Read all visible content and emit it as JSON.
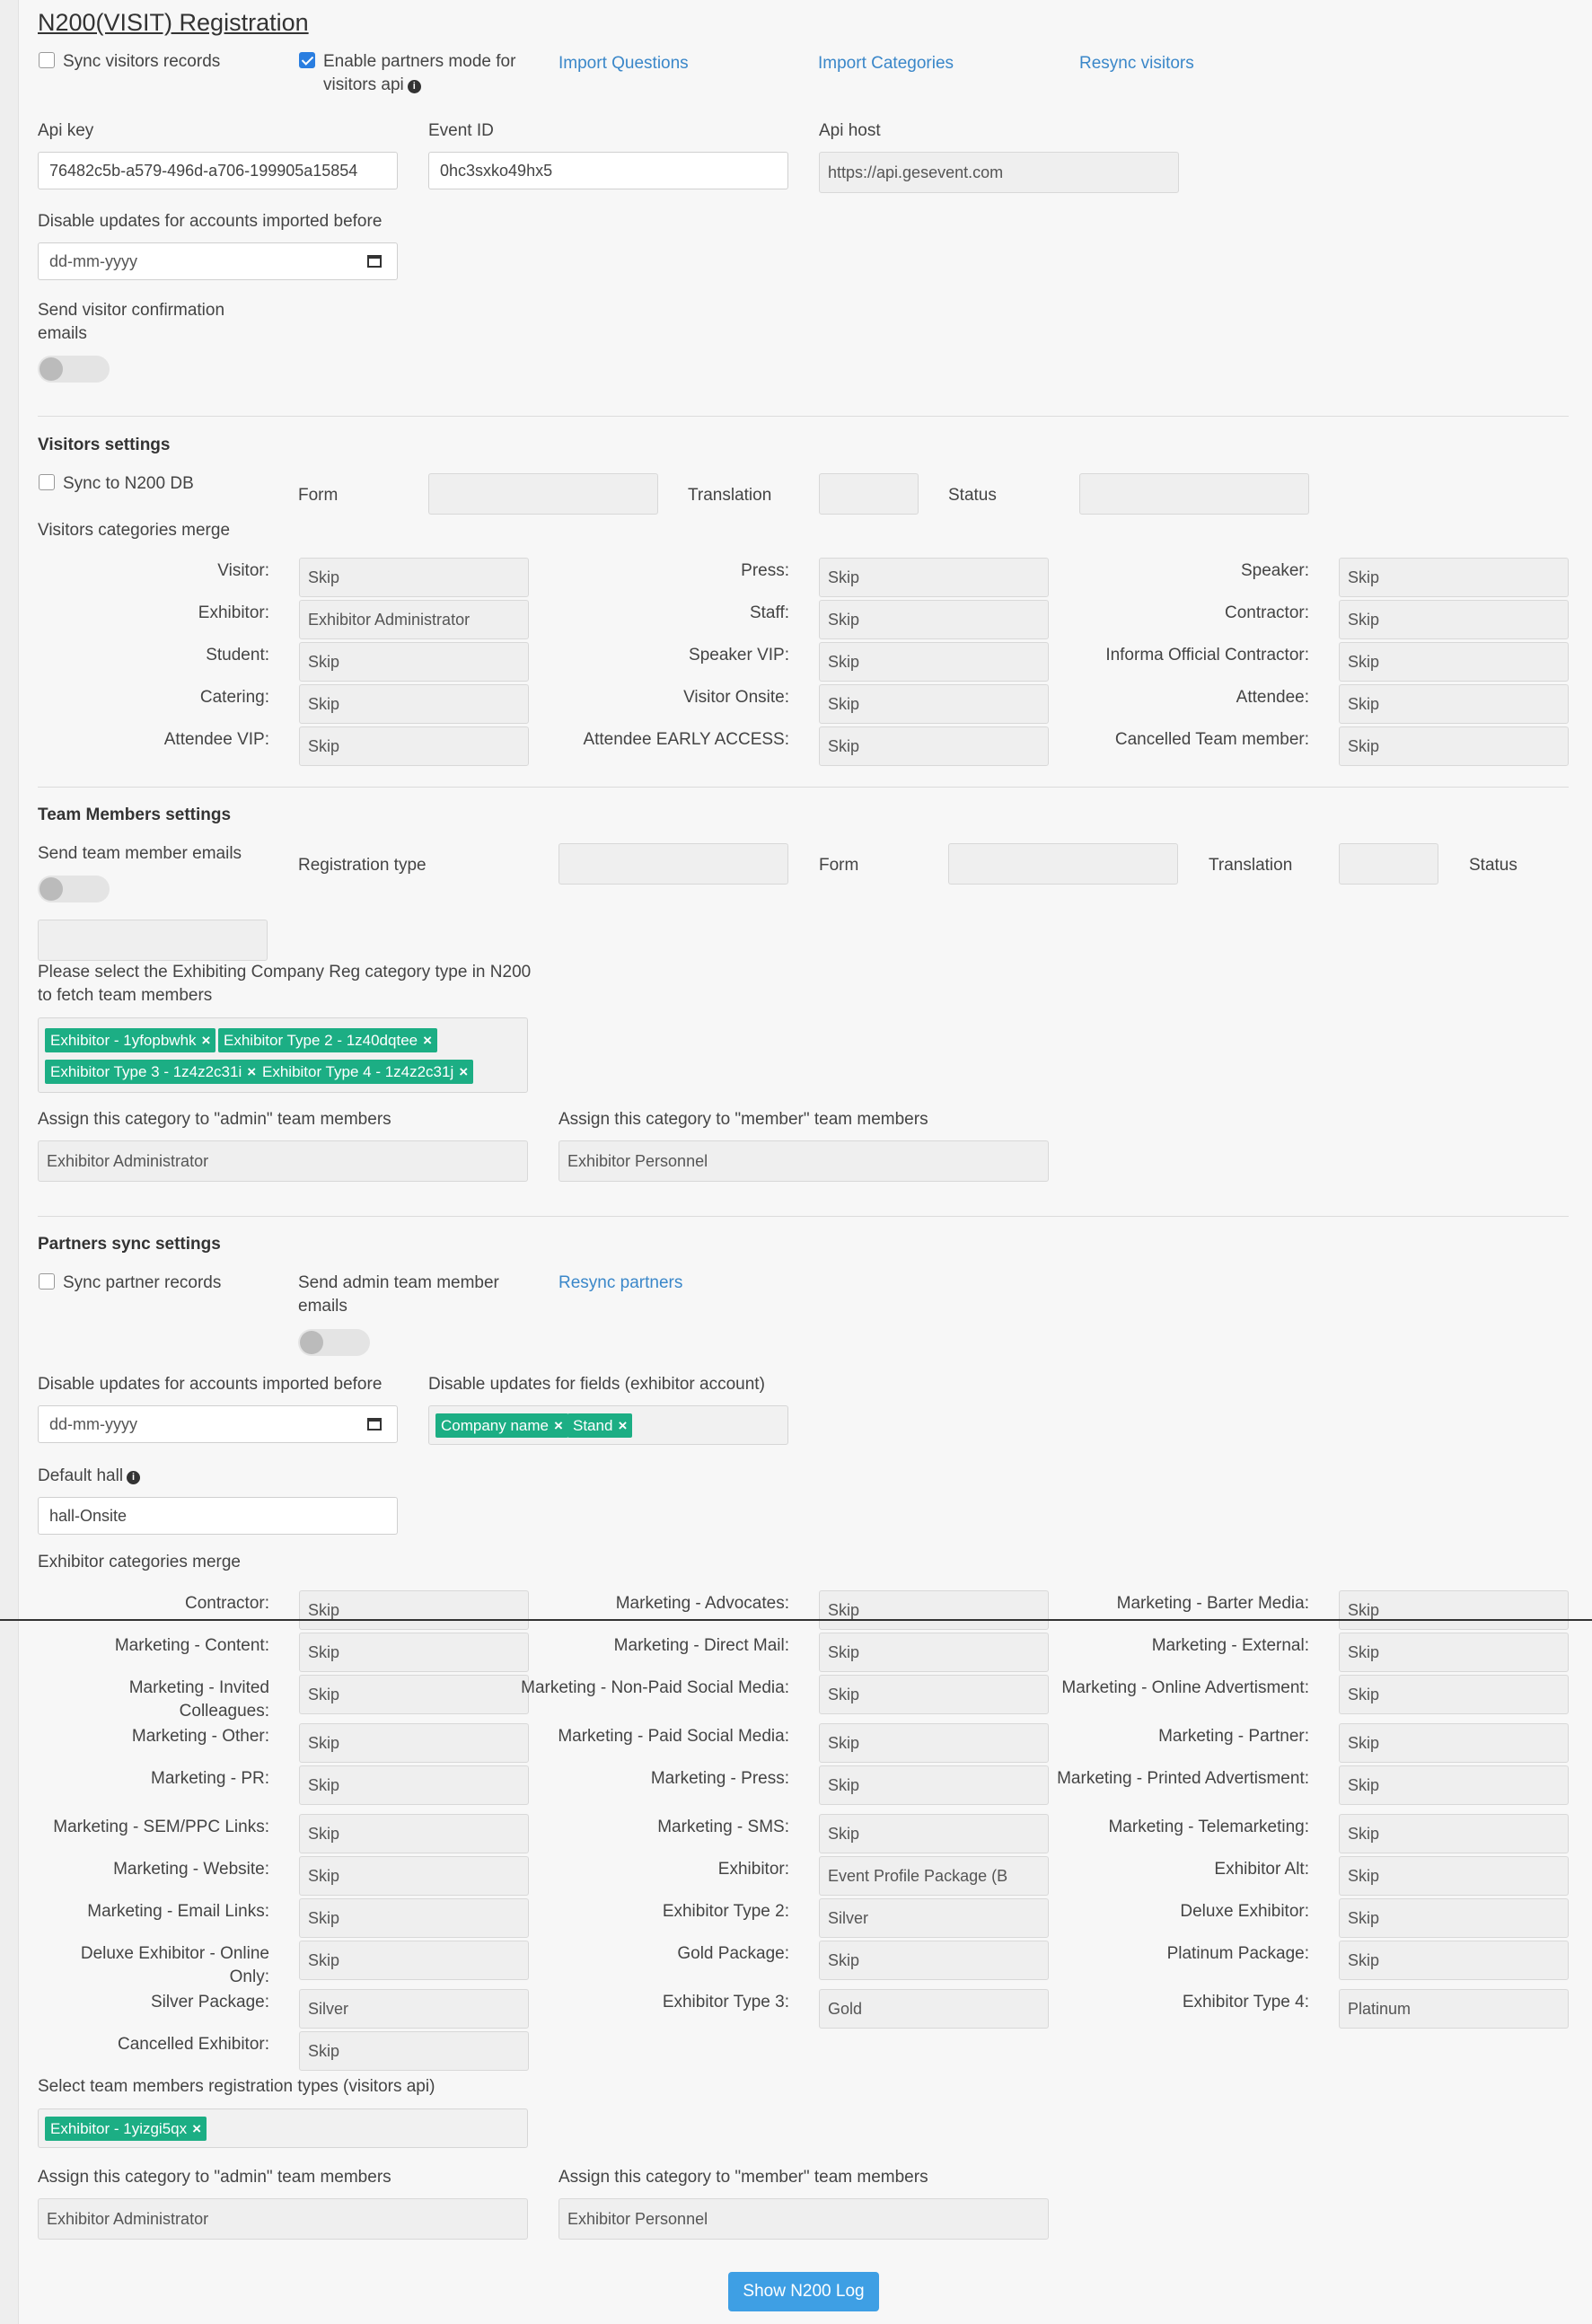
{
  "header": {
    "title": "N200(VISIT) Registration"
  },
  "top": {
    "sync_visitors": {
      "label": "Sync visitors records",
      "checked": false
    },
    "partners_mode": {
      "label": "Enable partners mode for visitors api",
      "checked": true,
      "icon": "info-icon"
    },
    "links": {
      "import_questions": "Import Questions",
      "import_categories": "Import Categories",
      "resync_visitors": "Resync visitors"
    },
    "api_key": {
      "label": "Api key",
      "value": "76482c5b-a579-496d-a706-199905a15854"
    },
    "event_id": {
      "label": "Event ID",
      "value": "0hc3sxko49hx5"
    },
    "api_host": {
      "label": "Api host",
      "value": "https://api.gesevent.com"
    },
    "disable_updates": {
      "label": "Disable updates for accounts imported before",
      "placeholder": "dd-mm-yyyy"
    },
    "send_confirmation": {
      "label": "Send visitor confirmation emails",
      "on": false
    }
  },
  "visitors": {
    "heading": "Visitors settings",
    "sync_db": {
      "label": "Sync to N200 DB",
      "checked": false
    },
    "form_label": "Form",
    "translation_label": "Translation",
    "status_label": "Status",
    "merge_title": "Visitors categories merge",
    "rows": [
      [
        {
          "label": "Visitor:",
          "value": "Skip"
        },
        {
          "label": "Press:",
          "value": "Skip"
        },
        {
          "label": "Speaker:",
          "value": "Skip"
        }
      ],
      [
        {
          "label": "Exhibitor:",
          "value": "Exhibitor Administrator"
        },
        {
          "label": "Staff:",
          "value": "Skip"
        },
        {
          "label": "Contractor:",
          "value": "Skip"
        }
      ],
      [
        {
          "label": "Student:",
          "value": "Skip"
        },
        {
          "label": "Speaker VIP:",
          "value": "Skip"
        },
        {
          "label": "Informa Official Contractor:",
          "value": "Skip"
        }
      ],
      [
        {
          "label": "Catering:",
          "value": "Skip"
        },
        {
          "label": "Visitor Onsite:",
          "value": "Skip"
        },
        {
          "label": "Attendee:",
          "value": "Skip"
        }
      ],
      [
        {
          "label": "Attendee VIP:",
          "value": "Skip"
        },
        {
          "label": "Attendee EARLY ACCESS:",
          "value": "Skip"
        },
        {
          "label": "Cancelled Team member:",
          "value": "Skip"
        }
      ]
    ]
  },
  "team": {
    "heading": "Team Members settings",
    "send_emails": {
      "label": "Send team member emails",
      "on": false
    },
    "registration_type_label": "Registration type",
    "form_label": "Form",
    "translation_label": "Translation",
    "status_label": "Status",
    "category_prompt": "Please select the Exhibiting Company Reg category type in N200 to fetch team members",
    "tags": [
      "Exhibitor - 1yfopbwhk",
      "Exhibitor Type 2 - 1z40dqtee",
      "Exhibitor Type 3 - 1z4z2c31i",
      "Exhibitor Type 4 - 1z4z2c31j"
    ],
    "admin_label": "Assign this category to \"admin\" team members",
    "admin_value": "Exhibitor Administrator",
    "member_label": "Assign this category to \"member\" team members",
    "member_value": "Exhibitor Personnel"
  },
  "partners": {
    "heading": "Partners sync settings",
    "sync_records": {
      "label": "Sync partner records",
      "checked": false
    },
    "send_admin": {
      "label": "Send admin team member emails",
      "on": false
    },
    "resync_link": "Resync partners",
    "disable_updates": {
      "label": "Disable updates for accounts imported before",
      "placeholder": "dd-mm-yyyy"
    },
    "disable_fields": {
      "label": "Disable updates for fields (exhibitor account)",
      "tags": [
        "Company name",
        "Stand"
      ]
    },
    "default_hall": {
      "label": "Default hall",
      "value": "hall-Onsite",
      "icon": "info-icon"
    },
    "merge_title": "Exhibitor categories merge",
    "rows": [
      [
        {
          "label": "Contractor:",
          "value": "Skip"
        },
        {
          "label": "Marketing - Advocates:",
          "value": "Skip"
        },
        {
          "label": "Marketing - Barter Media:",
          "value": "Skip"
        }
      ],
      [
        {
          "label": "Marketing - Content:",
          "value": "Skip"
        },
        {
          "label": "Marketing - Direct Mail:",
          "value": "Skip"
        },
        {
          "label": "Marketing - External:",
          "value": "Skip"
        }
      ],
      [
        {
          "label": "Marketing - Invited Colleagues:",
          "value": "Skip"
        },
        {
          "label": "Marketing - Non-Paid Social Media:",
          "value": "Skip"
        },
        {
          "label": "Marketing - Online Advertisment:",
          "value": "Skip"
        }
      ],
      [
        {
          "label": "Marketing - Other:",
          "value": "Skip"
        },
        {
          "label": "Marketing - Paid Social Media:",
          "value": "Skip"
        },
        {
          "label": "Marketing - Partner:",
          "value": "Skip"
        }
      ],
      [
        {
          "label": "Marketing - PR:",
          "value": "Skip"
        },
        {
          "label": "Marketing - Press:",
          "value": "Skip"
        },
        {
          "label": "Marketing - Printed Advertisment:",
          "value": "Skip"
        }
      ],
      [
        {
          "label": "Marketing - SEM/PPC Links:",
          "value": "Skip"
        },
        {
          "label": "Marketing - SMS:",
          "value": "Skip"
        },
        {
          "label": "Marketing - Telemarketing:",
          "value": "Skip"
        }
      ],
      [
        {
          "label": "Marketing - Website:",
          "value": "Skip"
        },
        {
          "label": "Exhibitor:",
          "value": "Event Profile Package (B"
        },
        {
          "label": "Exhibitor Alt:",
          "value": "Skip"
        }
      ],
      [
        {
          "label": "Marketing - Email Links:",
          "value": "Skip"
        },
        {
          "label": "Exhibitor Type 2:",
          "value": "Silver"
        },
        {
          "label": "Deluxe Exhibitor:",
          "value": "Skip"
        }
      ],
      [
        {
          "label": "Deluxe Exhibitor - Online Only:",
          "value": "Skip"
        },
        {
          "label": "Gold Package:",
          "value": "Skip"
        },
        {
          "label": "Platinum Package:",
          "value": "Skip"
        }
      ],
      [
        {
          "label": "Silver Package:",
          "value": "Silver"
        },
        {
          "label": "Exhibitor Type 3:",
          "value": "Gold"
        },
        {
          "label": "Exhibitor Type 4:",
          "value": "Platinum"
        }
      ],
      [
        {
          "label": "Cancelled Exhibitor:",
          "value": "Skip"
        }
      ]
    ],
    "team_types_label": "Select team members registration types (visitors api)",
    "team_types_tags": [
      "Exhibitor - 1yizgi5qx"
    ],
    "admin_label": "Assign this category to \"admin\" team members",
    "admin_value": "Exhibitor Administrator",
    "member_label": "Assign this category to \"member\" team members",
    "member_value": "Exhibitor Personnel"
  },
  "footer": {
    "show_log": "Show N200 Log"
  }
}
